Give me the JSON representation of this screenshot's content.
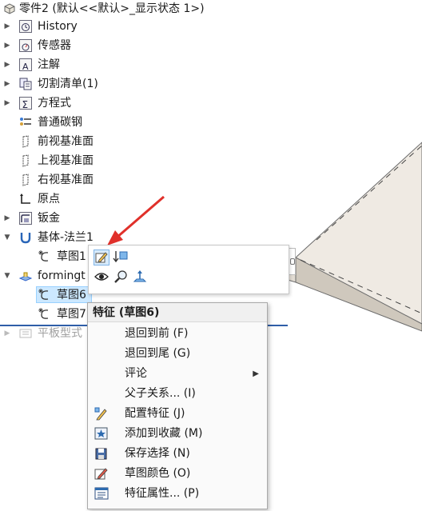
{
  "tree": {
    "root": "零件2 (默认<<默认>_显示状态 1>)",
    "items": [
      {
        "label": "History"
      },
      {
        "label": "传感器"
      },
      {
        "label": "注解"
      },
      {
        "label": "切割清单(1)"
      },
      {
        "label": "方程式"
      },
      {
        "label": "普通碳钢"
      },
      {
        "label": "前视基准面"
      },
      {
        "label": "上视基准面"
      },
      {
        "label": "右视基准面"
      },
      {
        "label": "原点"
      },
      {
        "label": "钣金"
      },
      {
        "label": "基体-法兰1"
      },
      {
        "label": "草图1"
      },
      {
        "label": "formingt"
      },
      {
        "label": "草图6"
      },
      {
        "label": "草图7"
      },
      {
        "label": "平板型式"
      }
    ]
  },
  "context_menu": {
    "title": "特征 (草图6)",
    "items": [
      {
        "label": "退回到前 (F)",
        "icon": "none"
      },
      {
        "label": "退回到尾 (G)",
        "icon": "none"
      },
      {
        "label": "评论",
        "icon": "none",
        "submenu": true
      },
      {
        "label": "父子关系... (I)",
        "icon": "none"
      },
      {
        "label": "配置特征 (J)",
        "icon": "configure-icon"
      },
      {
        "label": "添加到收藏 (M)",
        "icon": "favorite-star-icon"
      },
      {
        "label": "保存选择 (N)",
        "icon": "save-selection-icon"
      },
      {
        "label": "草图颜色 (O)",
        "icon": "sketch-color-icon"
      },
      {
        "label": "特征属性... (P)",
        "icon": "properties-icon"
      }
    ]
  },
  "colors": {
    "selection_bg": "#cce8ff",
    "selection_border": "#99d1ff",
    "accent_arrow": "#e0302a",
    "rollback_bar": "#2f5ea8",
    "plate_top": "#efeae3",
    "plate_edge": "#c9c2b8"
  }
}
